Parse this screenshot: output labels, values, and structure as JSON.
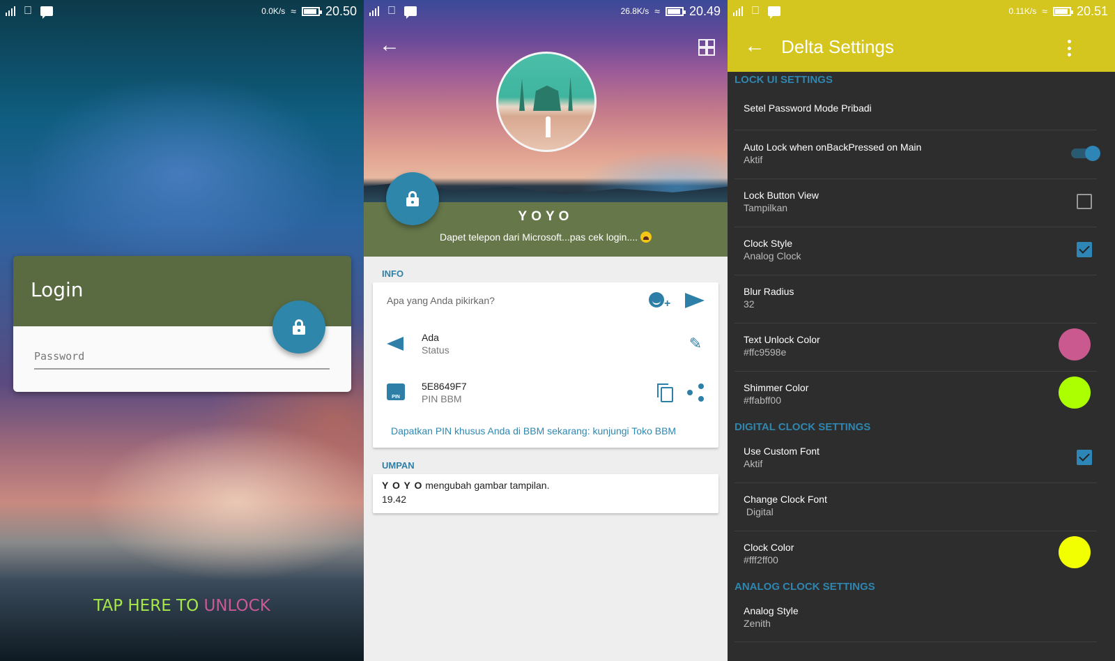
{
  "screens": [
    {
      "status_bar": {
        "net_speed": "0.0K/s",
        "time": "20.50"
      },
      "login": {
        "title": "Login",
        "password_placeholder": "Password",
        "unlock_button_icon": "lock-icon"
      },
      "tap_unlock": {
        "part1": "TAP HERE TO ",
        "part2": "UNLOCK"
      }
    },
    {
      "status_bar": {
        "net_speed": "26.8K/s",
        "time": "20.49"
      },
      "profile": {
        "name": "YOYO",
        "status_message": "Dapet telepon dari Microsoft...pas cek login....",
        "status_emoji": "crying-face"
      },
      "info": {
        "section_label": "INFO",
        "compose_placeholder": "Apa yang Anda pikirkan?",
        "status_row": {
          "title": "Ada",
          "subtitle": "Status"
        },
        "pin_row": {
          "title": "5E8649F7",
          "subtitle": "PIN BBM"
        },
        "pin_icon_label": "PIN",
        "pin_link": "Dapatkan PIN khusus Anda di BBM sekarang: kunjungi Toko BBM"
      },
      "feed": {
        "section_label": "UMPAN",
        "items": [
          {
            "name": "Y O Y O",
            "text": " mengubah gambar tampilan.",
            "time": "19.42"
          }
        ]
      }
    },
    {
      "status_bar": {
        "net_speed": "0.11K/s",
        "time": "20.51"
      },
      "app_bar": {
        "title": "Delta Settings"
      },
      "categories": [
        {
          "label": "LOCK UI SETTINGS"
        },
        {
          "label": "DIGITAL CLOCK SETTINGS"
        },
        {
          "label": "ANALOG CLOCK SETTINGS"
        }
      ],
      "preferences": [
        {
          "title": "Setel Password Mode Pribadi",
          "summary": ""
        },
        {
          "title": "Auto Lock when onBackPressed on Main",
          "summary": "Aktif",
          "widget": "switch",
          "checked": true
        },
        {
          "title": "Lock Button View",
          "summary": "Tampilkan",
          "widget": "checkbox",
          "checked": false
        },
        {
          "title": "Clock Style",
          "summary": "Analog Clock",
          "widget": "checkbox",
          "checked": true
        },
        {
          "title": "Blur Radius",
          "summary": "32"
        },
        {
          "title": "Text Unlock Color",
          "summary": "#ffc9598e",
          "widget": "color",
          "color": "#c9598e"
        },
        {
          "title": "Shimmer Color",
          "summary": "#ffabff00",
          "widget": "color",
          "color": "#abff00"
        },
        {
          "title": "Use Custom Font",
          "summary": "Aktif",
          "widget": "checkbox",
          "checked": true
        },
        {
          "title": "Change Clock Font",
          "summary": " Digital"
        },
        {
          "title": "Clock Color",
          "summary": "#fff2ff00",
          "widget": "color",
          "color": "#f2ff00"
        },
        {
          "title": "Analog Style",
          "summary": "Zenith"
        }
      ]
    }
  ],
  "colors": {
    "accent_blue": "#2e86ab",
    "login_header_green": "#5a6b42",
    "profile_band_green": "#66784a",
    "settings_app_bar": "#d4c61e",
    "settings_background": "#2d2d2d",
    "tap_text_green": "#a6e84a",
    "tap_text_pink": "#c95a95"
  }
}
